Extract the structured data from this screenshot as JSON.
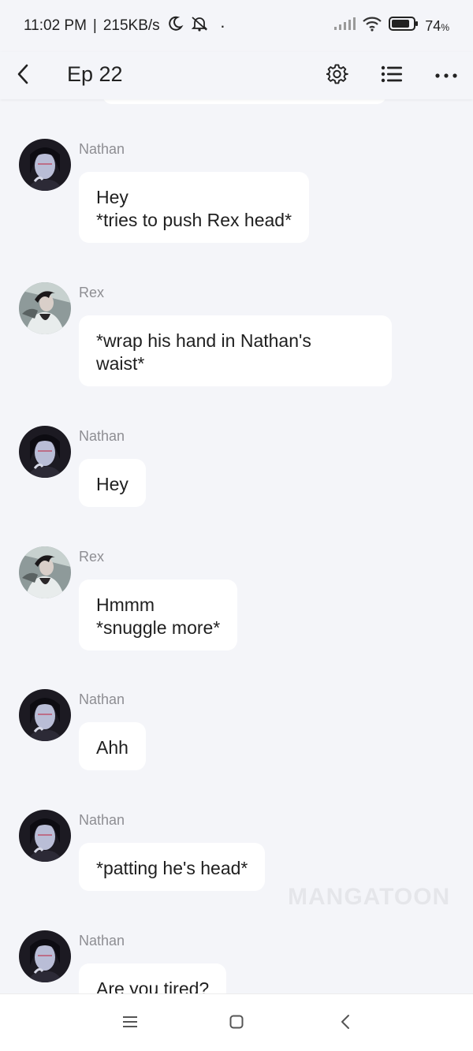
{
  "status_bar": {
    "time": "11:02 PM",
    "separator": "|",
    "network_speed": "215KB/s",
    "battery_percent": "74",
    "battery_unit": "%",
    "icons": [
      "moon-icon",
      "mute-icon",
      "signal-icon",
      "wifi-icon",
      "battery-icon"
    ]
  },
  "header": {
    "title": "Ep 22",
    "icons": [
      "back-icon",
      "gear-icon",
      "list-icon",
      "more-icon"
    ]
  },
  "colors": {
    "background": "#f4f5f9",
    "bubble": "#ffffff",
    "sender_name": "#8e8e93",
    "text": "#1f1f1f"
  },
  "messages": [
    {
      "sender": "Nathan",
      "text": "Hey\n*tries to push Rex head*"
    },
    {
      "sender": "Rex",
      "text": "*wrap his hand in Nathan's\nwaist*"
    },
    {
      "sender": "Nathan",
      "text": "Hey"
    },
    {
      "sender": "Rex",
      "text": "Hmmm\n*snuggle more*"
    },
    {
      "sender": "Nathan",
      "text": "Ahh"
    },
    {
      "sender": "Nathan",
      "text": "*patting he's head*"
    },
    {
      "sender": "Nathan",
      "text": "Are you tired?"
    }
  ],
  "watermark": "MANGATOON",
  "nav_bar": {
    "icons": [
      "menu-icon",
      "home-icon",
      "back-icon"
    ]
  }
}
